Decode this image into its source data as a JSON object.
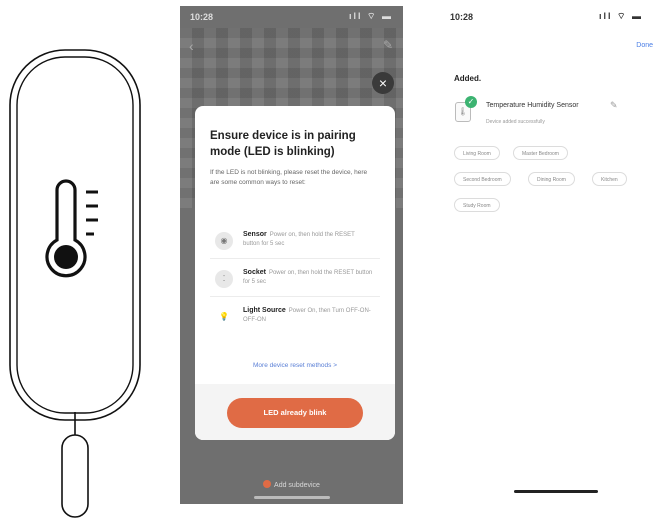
{
  "pairing_screen": {
    "status_time": "10:28",
    "status_icons": "ıll ⌔ ▬",
    "dialog": {
      "title": "Ensure device is in pairing mode (LED is blinking)",
      "description": "If the LED is not blinking, please reset the device, here are some common ways to reset:",
      "methods": [
        {
          "name": "Sensor",
          "text": "Power on, then hold the RESET button for 5 sec",
          "icon": "sensor-icon"
        },
        {
          "name": "Socket",
          "text": "Power on, then hold the RESET button for 5 sec",
          "icon": "socket-icon"
        },
        {
          "name": "Light Source",
          "text": "Power On, then Turn OFF-ON-OFF-ON",
          "icon": "bulb-icon"
        }
      ],
      "more_link": "More device reset methods >",
      "primary_button": "LED already blink"
    },
    "bottom_link": "Add subdevice"
  },
  "added_screen": {
    "status_time": "10:28",
    "status_icons": "ıll ⌔ ▬",
    "done_label": "Done",
    "title": "Added.",
    "device_name": "Temperature Humidity Sensor",
    "device_status": "Device added successfully",
    "rooms": [
      "Living Room",
      "Master Bedroom",
      "Second Bedroom",
      "Dining Room",
      "Kitchen",
      "Study Room"
    ]
  },
  "colors": {
    "accent": "#e06b45",
    "success": "#3cb371",
    "link": "#4a7ee6"
  }
}
